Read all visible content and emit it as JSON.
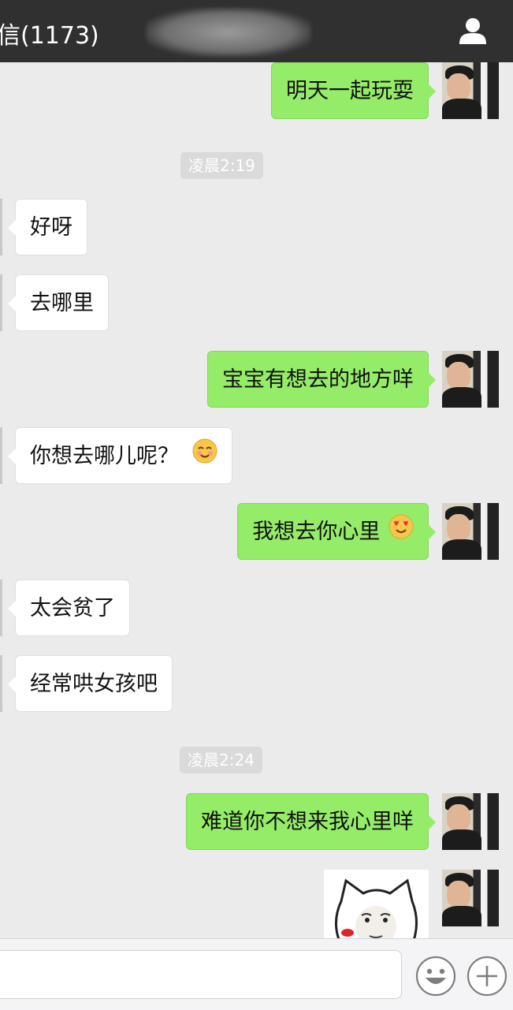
{
  "header": {
    "title": "信(1173)",
    "profile_icon": "person-icon"
  },
  "timestamps": [
    "凌晨2:19",
    "凌晨2:24"
  ],
  "messages": [
    {
      "side": "out",
      "text": "明天一起玩耍"
    },
    {
      "side": "in",
      "text": "好呀"
    },
    {
      "side": "in",
      "text": "去哪里"
    },
    {
      "side": "out",
      "text": "宝宝有想去的地方咩"
    },
    {
      "side": "in",
      "text": "你想去哪儿呢？",
      "emoji": "blush-smile-emoji"
    },
    {
      "side": "out",
      "text": "我想去你心里",
      "emoji": "heart-eyes-emoji"
    },
    {
      "side": "in",
      "text": "太会贫了"
    },
    {
      "side": "in",
      "text": "经常哄女孩吧"
    },
    {
      "side": "out",
      "text": "难道你不想来我心里咩"
    },
    {
      "side": "out",
      "type": "sticker",
      "sticker": "cat-face-kiss-sticker"
    }
  ],
  "input_bar": {
    "input_value": "",
    "emoji_button_icon": "smiley-face-icon",
    "plus_button_icon": "plus-circle-icon"
  },
  "colors": {
    "header_bg": "#303030",
    "chat_bg": "#ebebeb",
    "outgoing_bubble": "#95ec69",
    "incoming_bubble": "#ffffff",
    "timestamp_bg": "#dadada"
  }
}
